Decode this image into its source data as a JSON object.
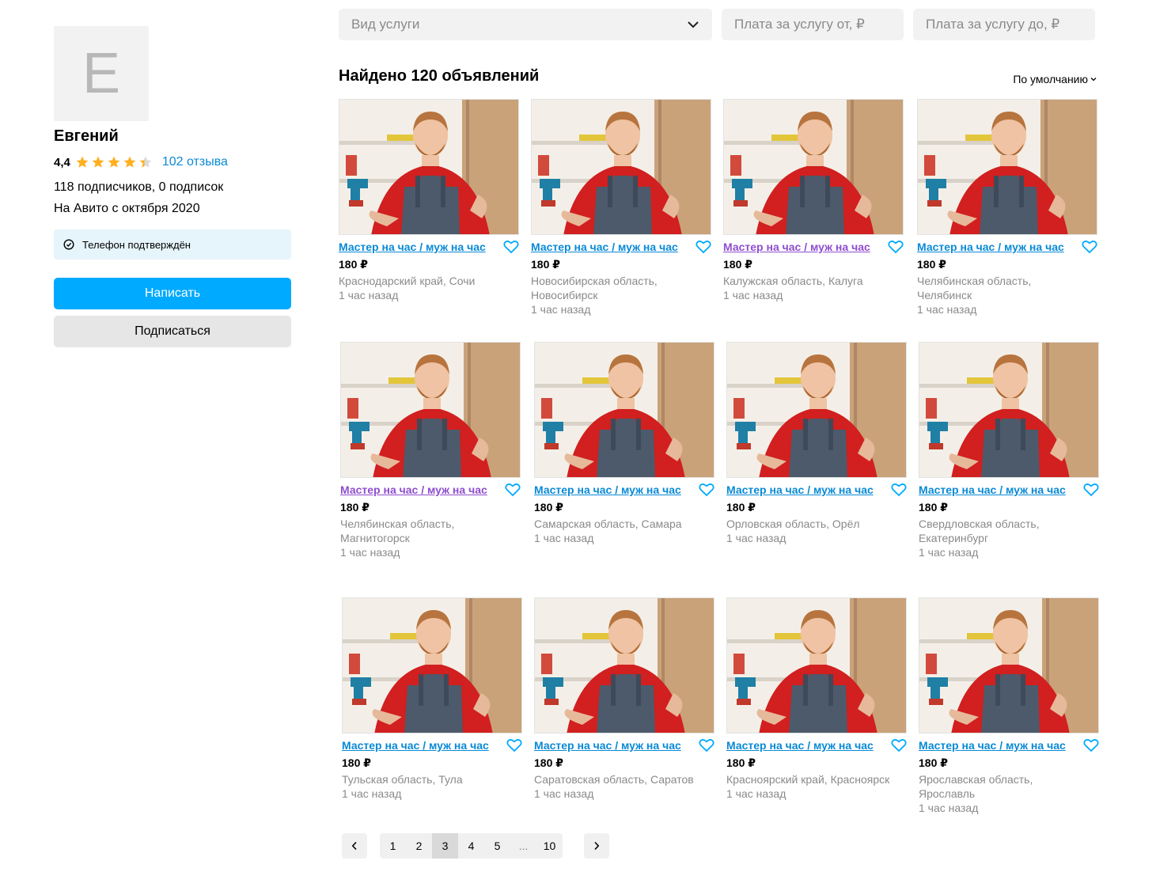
{
  "profile": {
    "avatar_letter": "Е",
    "name": "Евгений",
    "rating": "4,4",
    "stars_value": 4.4,
    "reviews_link": "102 отзыва",
    "subscribers": "118 подписчиков, 0 подписок",
    "since": "На Авито с октября 2020",
    "phone_badge": "Телефон подтверждён",
    "write_button": "Написать",
    "subscribe_button": "Подписаться"
  },
  "filters": {
    "service_type": "Вид услуги",
    "price_from": "Плата за услугу от, ₽",
    "price_to": "Плата за услугу до, ₽"
  },
  "results": {
    "title": "Найдено 120 объявлений",
    "sort_label": "По умолчанию"
  },
  "colors": {
    "accent": "#00aaff",
    "link": "#0a8ad6",
    "visited_link": "#8f4ecf",
    "star": "#ffb021"
  },
  "listings": [
    {
      "title": "Мастер на час / муж на час",
      "price": "180 ₽",
      "location": "Краснодарский край, Сочи",
      "time": "1 час назад",
      "visited": false
    },
    {
      "title": "Мастер на час / муж на час",
      "price": "180 ₽",
      "location": "Новосибирская область, Новосибирск",
      "time": "1 час назад",
      "visited": false
    },
    {
      "title": "Мастер на час / муж на час",
      "price": "180 ₽",
      "location": "Калужская область, Калуга",
      "time": "1 час назад",
      "visited": true
    },
    {
      "title": "Мастер на час / муж на час",
      "price": "180 ₽",
      "location": "Челябинская область, Челябинск",
      "time": "1 час назад",
      "visited": false
    },
    {
      "title": "Мастер на час / муж на час",
      "price": "180 ₽",
      "location": "Челябинская область, Магнитогорск",
      "time": "1 час назад",
      "visited": true
    },
    {
      "title": "Мастер на час / муж на час",
      "price": "180 ₽",
      "location": "Самарская область, Самара",
      "time": "1 час назад",
      "visited": false
    },
    {
      "title": "Мастер на час / муж на час",
      "price": "180 ₽",
      "location": "Орловская область, Орёл",
      "time": "1 час назад",
      "visited": false
    },
    {
      "title": "Мастер на час / муж на час",
      "price": "180 ₽",
      "location": "Свердловская область, Екатеринбург",
      "time": "1 час назад",
      "visited": false
    },
    {
      "title": "Мастер на час / муж на час",
      "price": "180 ₽",
      "location": "Тульская область, Тула",
      "time": "1 час назад",
      "visited": false
    },
    {
      "title": "Мастер на час / муж на час",
      "price": "180 ₽",
      "location": "Саратовская область, Саратов",
      "time": "1 час назад",
      "visited": false
    },
    {
      "title": "Мастер на час / муж на час",
      "price": "180 ₽",
      "location": "Красноярский край, Красноярск",
      "time": "1 час назад",
      "visited": false
    },
    {
      "title": "Мастер на час / муж на час",
      "price": "180 ₽",
      "location": "Ярославская область, Ярославль",
      "time": "1 час назад",
      "visited": false
    }
  ],
  "pagination": {
    "pages": [
      "1",
      "2",
      "3",
      "4",
      "5",
      "...",
      "10"
    ],
    "current": "3"
  }
}
